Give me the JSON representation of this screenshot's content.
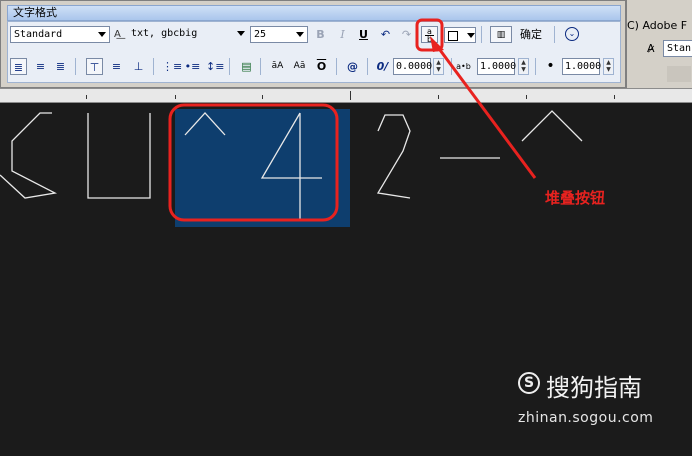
{
  "toolbar": {
    "title": "文字格式",
    "style_value": "Standard",
    "font_value": "txt, gbcbig",
    "height_value": "25",
    "bold_label": "B",
    "italic_label": "I",
    "underline_label": "U",
    "ok_label": "确定",
    "ok_icon": "circle-chevron-down-icon",
    "oblique_value": "0.0000",
    "tracking_value": "1.0000",
    "width_value": "1.0000",
    "upper_label": "āA",
    "lower_label": "Aā",
    "overline_label": "O",
    "symbol_label": "@",
    "oblique_label": "0/",
    "tracking_label": "a•b",
    "width_label": "•"
  },
  "right_window": {
    "menu_fragment": "C)  Adobe F",
    "style_fragment": "Stan"
  },
  "canvas": {
    "selected_text": "4",
    "highlight_color": "#0e3e6e"
  },
  "annotation": {
    "label": "堆叠按钮",
    "color": "#e8221f"
  },
  "watermark": {
    "text": "搜狗指南",
    "url": "zhinan.sogou.com"
  }
}
